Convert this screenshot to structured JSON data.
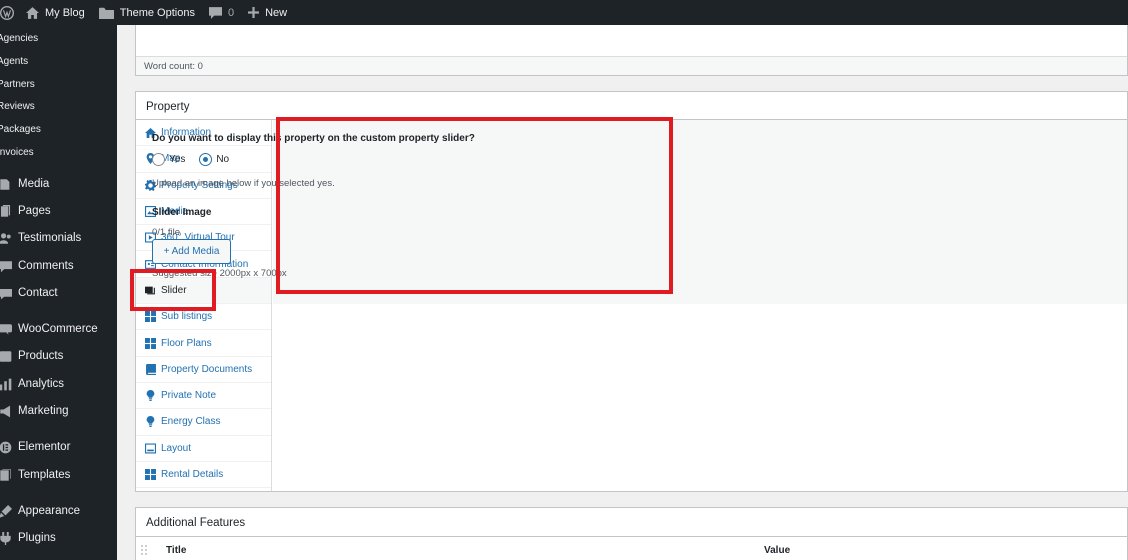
{
  "admin_bar": {
    "site_name": "My Blog",
    "theme_options": "Theme Options",
    "comments_count": "0",
    "new_label": "New"
  },
  "sidebar": {
    "sub_items": [
      "Agencies",
      "Agents",
      "Partners",
      "Reviews",
      "Packages",
      "Invoices"
    ],
    "items": [
      {
        "label": "Media",
        "icon": "media-icon"
      },
      {
        "label": "Pages",
        "icon": "pages-icon"
      },
      {
        "label": "Testimonials",
        "icon": "testimonials-icon"
      },
      {
        "label": "Comments",
        "icon": "comments-icon"
      },
      {
        "label": "Contact",
        "icon": "contact-icon"
      },
      {
        "label": "WooCommerce",
        "icon": "woocommerce-icon"
      },
      {
        "label": "Products",
        "icon": "products-icon"
      },
      {
        "label": "Analytics",
        "icon": "analytics-icon"
      },
      {
        "label": "Marketing",
        "icon": "marketing-icon"
      },
      {
        "label": "Elementor",
        "icon": "elementor-icon"
      },
      {
        "label": "Templates",
        "icon": "templates-icon"
      },
      {
        "label": "Appearance",
        "icon": "appearance-icon"
      },
      {
        "label": "Plugins",
        "icon": "plugins-icon"
      }
    ]
  },
  "editor": {
    "word_count": "Word count: 0"
  },
  "property": {
    "title": "Property",
    "tabs": [
      {
        "label": "Information",
        "icon": "home-icon"
      },
      {
        "label": "Map",
        "icon": "map-pin-icon"
      },
      {
        "label": "Property Settings",
        "icon": "gear-icon"
      },
      {
        "label": "Media",
        "icon": "image-icon"
      },
      {
        "label": "360° Virtual Tour",
        "icon": "video-icon"
      },
      {
        "label": "Contact Information",
        "icon": "id-card-icon"
      },
      {
        "label": "Slider",
        "icon": "slider-icon"
      },
      {
        "label": "Sub listings",
        "icon": "grid-icon"
      },
      {
        "label": "Floor Plans",
        "icon": "grid-icon"
      },
      {
        "label": "Property Documents",
        "icon": "book-icon"
      },
      {
        "label": "Private Note",
        "icon": "lightbulb-icon"
      },
      {
        "label": "Energy Class",
        "icon": "lightbulb-icon"
      },
      {
        "label": "Layout",
        "icon": "layout-icon"
      },
      {
        "label": "Rental Details",
        "icon": "grid-icon"
      }
    ],
    "active_tab": "Slider",
    "question": "Do you want to display this property on the custom property slider?",
    "options": [
      "Yes",
      "No"
    ],
    "selected": "No",
    "hint": "Upload an image below if you selected yes.",
    "slider_image_label": "Slider Image",
    "file_count": "0/1 file",
    "add_media_label": "+ Add Media",
    "suggested_size": "Suggested size 2000px x 700px"
  },
  "additional_features": {
    "title": "Additional Features",
    "columns": [
      "Title",
      "Value"
    ]
  },
  "colors": {
    "highlight": "#e11b22",
    "accent": "#2271b1",
    "admin_dark": "#1d2327"
  }
}
